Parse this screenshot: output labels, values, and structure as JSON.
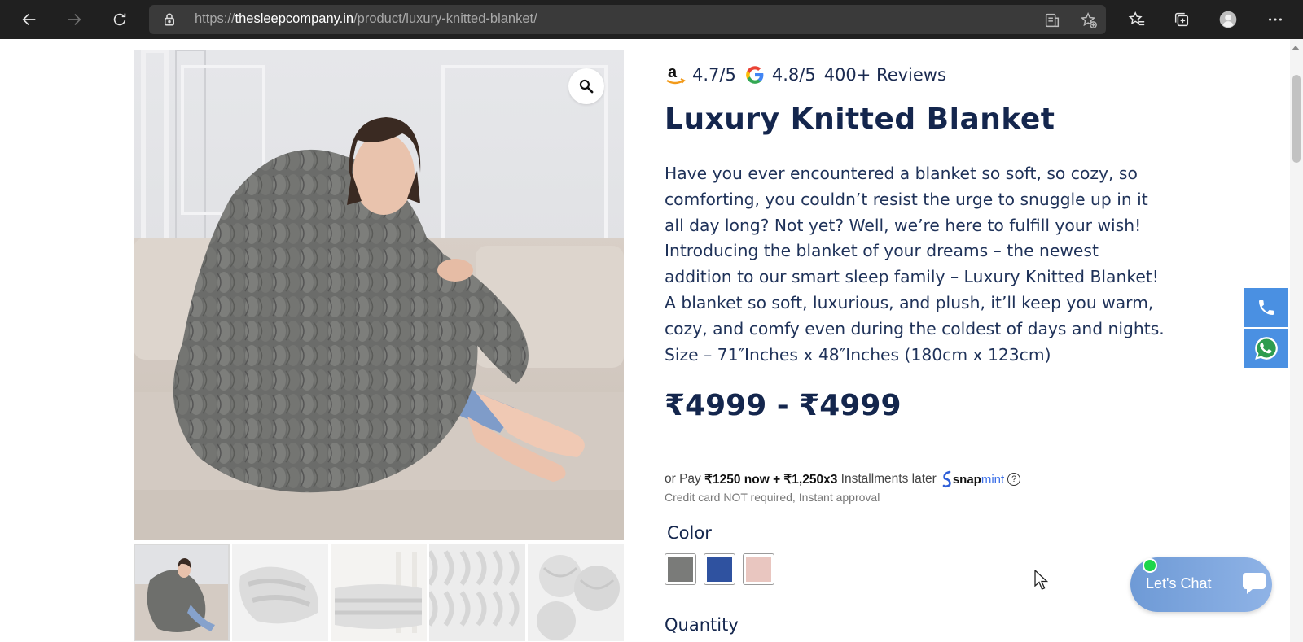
{
  "browser": {
    "url_prefix": "https://",
    "url_domain": "thesleepcompany.in",
    "url_path": "/product/luxury-knitted-blanket/"
  },
  "product": {
    "ratings": {
      "amazon": "4.7/5",
      "google": "4.8/5",
      "reviews": "400+ Reviews"
    },
    "title": "Luxury Knitted Blanket",
    "description_lines": [
      "Have you ever encountered a blanket so soft, so cozy, so",
      "comforting, you couldn’t resist the urge to snuggle up in it",
      "all day long? Not yet? Well, we’re here to fulfill your wish!",
      "Introducing the blanket of your dreams – the newest",
      "addition to our smart sleep family – Luxury Knitted Blanket!",
      "A blanket so soft, luxurious, and plush, it’ll keep you warm,",
      "cozy, and comfy even during the coldest of days and nights.",
      "Size – 71″Inches x 48″Inches (180cm x 123cm)"
    ],
    "price": "₹4999 - ₹4999",
    "emi": {
      "prefix": "or Pay",
      "amount": "₹1250 now + ₹1,250x3",
      "suffix": "Installments later",
      "brand_a": "snap",
      "brand_b": "mint",
      "help": "?",
      "note": "Credit card NOT required, Instant approval"
    },
    "color_label": "Color",
    "colors": [
      {
        "name": "grey",
        "hex": "#7a7b79"
      },
      {
        "name": "blue",
        "hex": "#2f52a0"
      },
      {
        "name": "pink",
        "hex": "#e9c6c0"
      }
    ],
    "quantity_label": "Quantity"
  },
  "chat": {
    "label": "Let's Chat"
  },
  "icons": {
    "back": "back-arrow-icon",
    "forward": "forward-arrow-icon",
    "refresh": "refresh-icon",
    "lock": "lock-icon",
    "zoom": "magnifier-icon",
    "phone": "phone-icon",
    "whatsapp": "whatsapp-icon"
  }
}
